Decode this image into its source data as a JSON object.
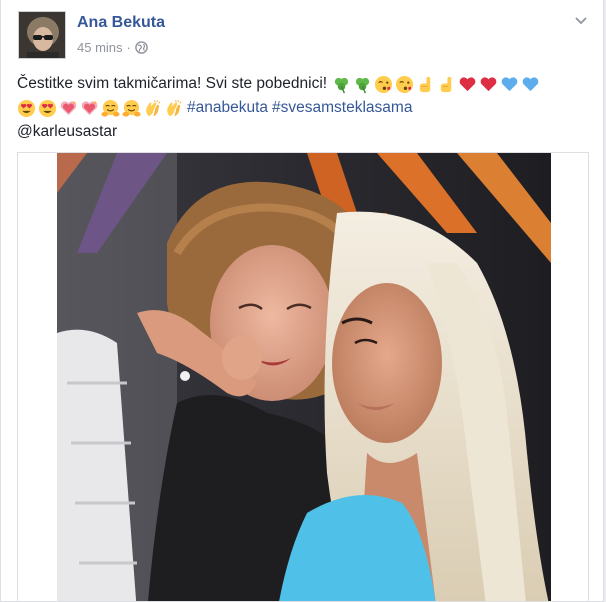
{
  "post": {
    "author_name": "Ana Bekuta",
    "timestamp": "45 mins",
    "separator": "·",
    "privacy_icon": "globe-icon",
    "menu_icon": "chevron-down-icon",
    "text_line1": "Čestitke svim takmičarima! Svi ste pobednici!",
    "hashtags": [
      "#anabekuta",
      "#svesamsteklasama"
    ],
    "mention": "@karleusastar",
    "emojis_line1": [
      "shamrock",
      "shamrock",
      "kissing-face",
      "kissing-face",
      "pointing-hand",
      "pointing-hand",
      "red-heart",
      "red-heart",
      "blue-heart",
      "blue-heart"
    ],
    "emojis_line2": [
      "heart-eyes",
      "heart-eyes",
      "sparkling-heart",
      "sparkling-heart",
      "hugging-face",
      "hugging-face",
      "clapping-hands",
      "clapping-hands"
    ]
  },
  "colors": {
    "link_blue": "#365899",
    "meta_gray": "#90949c",
    "text": "#1d2129"
  }
}
